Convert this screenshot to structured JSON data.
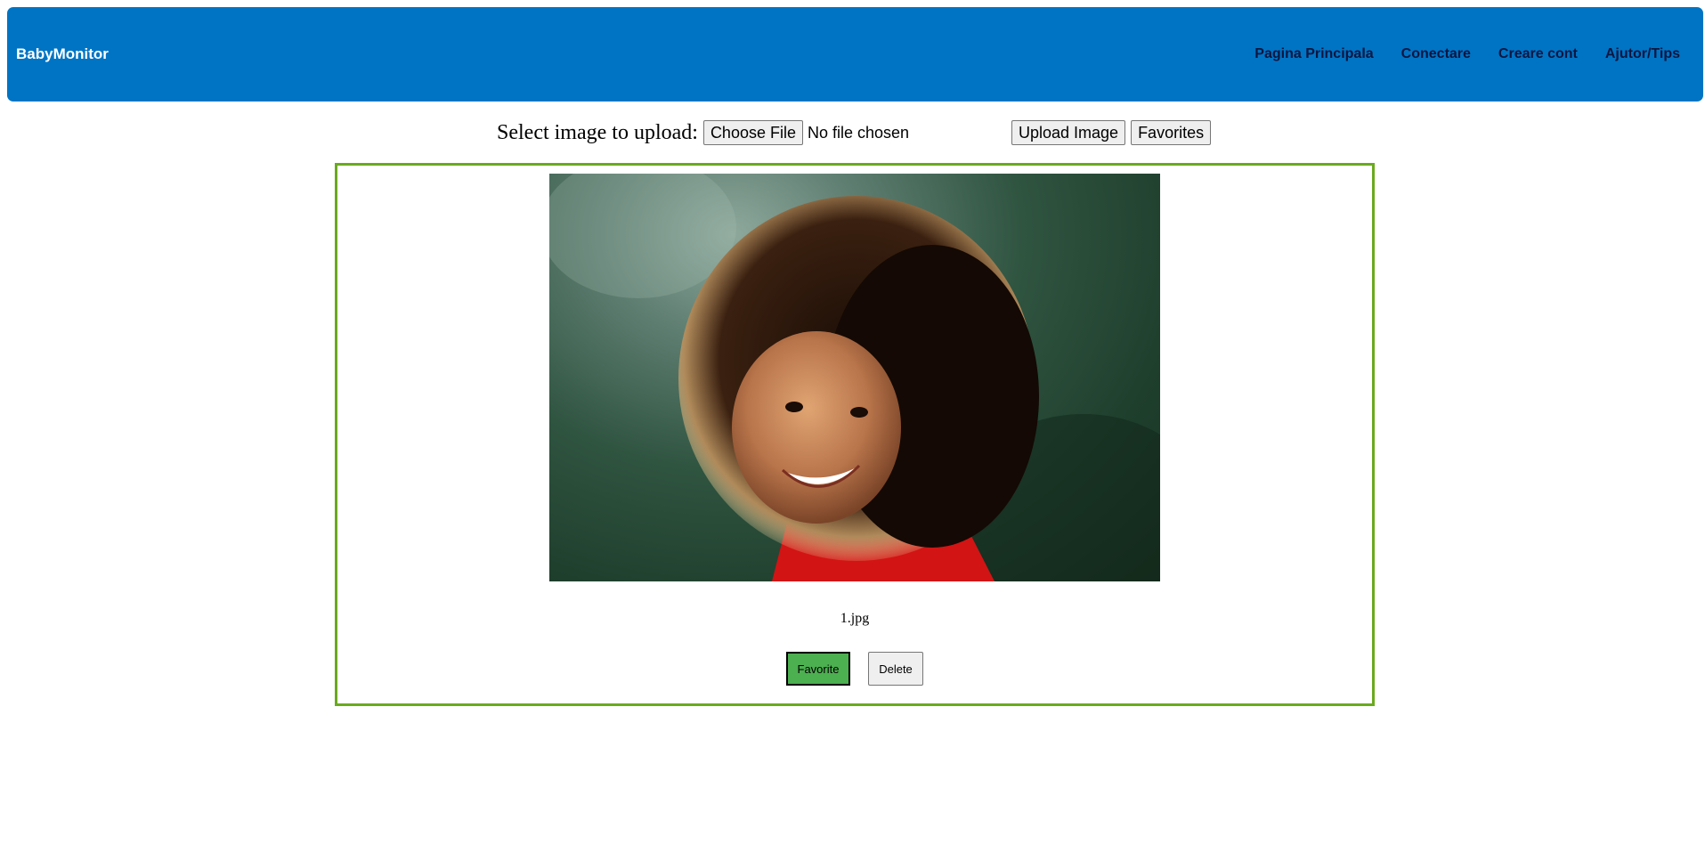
{
  "header": {
    "brand": "BabyMonitor",
    "nav": [
      {
        "label": "Pagina Principala"
      },
      {
        "label": "Conectare"
      },
      {
        "label": "Creare cont"
      },
      {
        "label": "Ajutor/Tips"
      }
    ]
  },
  "upload": {
    "label": "Select image to upload:",
    "choose_file_label": "Choose File",
    "no_file_text": "No file chosen",
    "upload_button_label": "Upload Image",
    "favorites_button_label": "Favorites"
  },
  "gallery": {
    "items": [
      {
        "filename": "1.jpg",
        "favorite_label": "Favorite",
        "delete_label": "Delete"
      }
    ]
  },
  "colors": {
    "header_bg": "#0074c4",
    "card_border": "#6aaa1e",
    "favorite_bg": "#4caf50"
  }
}
